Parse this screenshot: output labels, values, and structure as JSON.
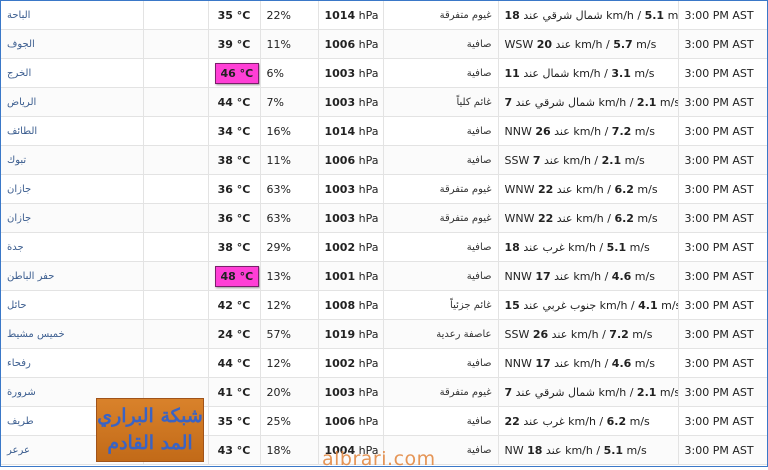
{
  "rows": [
    {
      "city": "الباحة",
      "temp": "35 °C",
      "humidity": "22%",
      "pressure": "1014",
      "pressure_unit": "hPa",
      "condition": "غيوم متفرقة",
      "wind_pre": "",
      "wind_bold": "18",
      "wind_mid": " شمال شرقي عند ",
      "wind_kmh": "km/h / ",
      "wind_ms": "5.1",
      "wind_ms_unit": " m/s",
      "time": "3:00 PM AST",
      "hot": false
    },
    {
      "city": "الجوف",
      "temp": "39 °C",
      "humidity": "11%",
      "pressure": "1006",
      "pressure_unit": "hPa",
      "condition": "صافية",
      "wind_pre": "WSW ",
      "wind_bold": "20",
      "wind_mid": " عند ",
      "wind_kmh": "km/h / ",
      "wind_ms": "5.7",
      "wind_ms_unit": " m/s",
      "time": "3:00 PM AST",
      "hot": false
    },
    {
      "city": "الخرج",
      "temp": "46 °C",
      "humidity": "6%",
      "pressure": "1003",
      "pressure_unit": "hPa",
      "condition": "صافية",
      "wind_pre": "",
      "wind_bold": "11",
      "wind_mid": " شمال عند ",
      "wind_kmh": "km/h / ",
      "wind_ms": "3.1",
      "wind_ms_unit": " m/s",
      "time": "3:00 PM AST",
      "hot": true
    },
    {
      "city": "الرياض",
      "temp": "44 °C",
      "humidity": "7%",
      "pressure": "1003",
      "pressure_unit": "hPa",
      "condition": "غائم كلياً",
      "wind_pre": "",
      "wind_bold": "7",
      "wind_mid": " شمال شرقي عند ",
      "wind_kmh": "km/h / ",
      "wind_ms": "2.1",
      "wind_ms_unit": " m/s",
      "time": "3:00 PM AST",
      "hot": false
    },
    {
      "city": "الطائف",
      "temp": "34 °C",
      "humidity": "16%",
      "pressure": "1014",
      "pressure_unit": "hPa",
      "condition": "صافية",
      "wind_pre": "NNW ",
      "wind_bold": "26",
      "wind_mid": " عند ",
      "wind_kmh": "km/h / ",
      "wind_ms": "7.2",
      "wind_ms_unit": " m/s",
      "time": "3:00 PM AST",
      "hot": false
    },
    {
      "city": "تبوك",
      "temp": "38 °C",
      "humidity": "11%",
      "pressure": "1006",
      "pressure_unit": "hPa",
      "condition": "صافية",
      "wind_pre": "SSW ",
      "wind_bold": "7",
      "wind_mid": " عند ",
      "wind_kmh": "km/h / ",
      "wind_ms": "2.1",
      "wind_ms_unit": " m/s",
      "time": "3:00 PM AST",
      "hot": false
    },
    {
      "city": "جازان",
      "temp": "36 °C",
      "humidity": "63%",
      "pressure": "1003",
      "pressure_unit": "hPa",
      "condition": "غيوم متفرقة",
      "wind_pre": "WNW ",
      "wind_bold": "22",
      "wind_mid": " عند ",
      "wind_kmh": "km/h / ",
      "wind_ms": "6.2",
      "wind_ms_unit": " m/s",
      "time": "3:00 PM AST",
      "hot": false
    },
    {
      "city": "جازان",
      "temp": "36 °C",
      "humidity": "63%",
      "pressure": "1003",
      "pressure_unit": "hPa",
      "condition": "غيوم متفرقة",
      "wind_pre": "WNW ",
      "wind_bold": "22",
      "wind_mid": " عند ",
      "wind_kmh": "km/h / ",
      "wind_ms": "6.2",
      "wind_ms_unit": " m/s",
      "time": "3:00 PM AST",
      "hot": false
    },
    {
      "city": "جدة",
      "temp": "38 °C",
      "humidity": "29%",
      "pressure": "1002",
      "pressure_unit": "hPa",
      "condition": "صافية",
      "wind_pre": "",
      "wind_bold": "18",
      "wind_mid": " غرب عند ",
      "wind_kmh": "km/h / ",
      "wind_ms": "5.1",
      "wind_ms_unit": " m/s",
      "time": "3:00 PM AST",
      "hot": false
    },
    {
      "city": "حفر الباطن",
      "temp": "48 °C",
      "humidity": "13%",
      "pressure": "1001",
      "pressure_unit": "hPa",
      "condition": "صافية",
      "wind_pre": "NNW ",
      "wind_bold": "17",
      "wind_mid": " عند ",
      "wind_kmh": "km/h / ",
      "wind_ms": "4.6",
      "wind_ms_unit": " m/s",
      "time": "3:00 PM AST",
      "hot": true
    },
    {
      "city": "حائل",
      "temp": "42 °C",
      "humidity": "12%",
      "pressure": "1008",
      "pressure_unit": "hPa",
      "condition": "غائم جزئياً",
      "wind_pre": "",
      "wind_bold": "15",
      "wind_mid": " جنوب غربي عند ",
      "wind_kmh": "km/h / ",
      "wind_ms": "4.1",
      "wind_ms_unit": " m/s",
      "time": "3:00 PM AST",
      "hot": false
    },
    {
      "city": "خميس مشيط",
      "temp": "24 °C",
      "humidity": "57%",
      "pressure": "1019",
      "pressure_unit": "hPa",
      "condition": "عاصفة رعدية",
      "wind_pre": "SSW ",
      "wind_bold": "26",
      "wind_mid": " عند ",
      "wind_kmh": "km/h / ",
      "wind_ms": "7.2",
      "wind_ms_unit": " m/s",
      "time": "3:00 PM AST",
      "hot": false
    },
    {
      "city": "رفحاء",
      "temp": "44 °C",
      "humidity": "12%",
      "pressure": "1002",
      "pressure_unit": "hPa",
      "condition": "صافية",
      "wind_pre": "NNW ",
      "wind_bold": "17",
      "wind_mid": " عند ",
      "wind_kmh": "km/h / ",
      "wind_ms": "4.6",
      "wind_ms_unit": " m/s",
      "time": "3:00 PM AST",
      "hot": false
    },
    {
      "city": "شرورة",
      "temp": "41 °C",
      "humidity": "20%",
      "pressure": "1003",
      "pressure_unit": "hPa",
      "condition": "غيوم متفرقة",
      "wind_pre": "",
      "wind_bold": "7",
      "wind_mid": " شمال شرقي عند ",
      "wind_kmh": "km/h / ",
      "wind_ms": "2.1",
      "wind_ms_unit": " m/s",
      "time": "3:00 PM AST",
      "hot": false
    },
    {
      "city": "طريف",
      "temp": "35 °C",
      "humidity": "25%",
      "pressure": "1006",
      "pressure_unit": "hPa",
      "condition": "صافية",
      "wind_pre": "",
      "wind_bold": "22",
      "wind_mid": " غرب عند ",
      "wind_kmh": "km/h / ",
      "wind_ms": "6.2",
      "wind_ms_unit": " m/s",
      "time": "3:00 PM AST",
      "hot": false
    },
    {
      "city": "عرعر",
      "temp": "43 °C",
      "humidity": "18%",
      "pressure": "1004",
      "pressure_unit": "hPa",
      "condition": "صافية",
      "wind_pre": "NW ",
      "wind_bold": "18",
      "wind_mid": " عند ",
      "wind_kmh": "km/h / ",
      "wind_ms": "5.1",
      "wind_ms_unit": " m/s",
      "time": "3:00 PM AST",
      "hot": false
    }
  ],
  "logo": {
    "line1": "شبكة البراري",
    "line2": "المد القادم"
  },
  "watermark": "albrari.com",
  "colors": {
    "hot_highlight": "#ff3fd6",
    "border": "#3a78c8",
    "logo_bg": "#d9822b",
    "logo_text": "#3a63c4"
  }
}
